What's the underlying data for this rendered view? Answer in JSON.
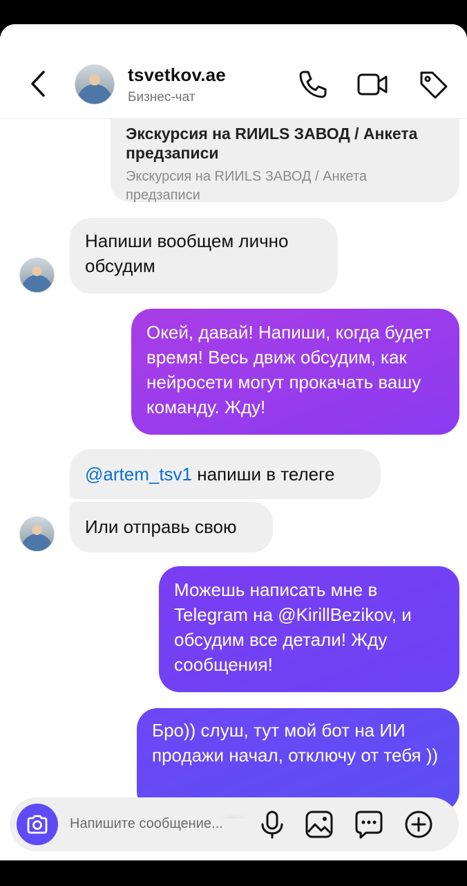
{
  "header": {
    "title": "tsvetkov.ae",
    "subtitle": "Бизнес-чат"
  },
  "messages": {
    "quoted": {
      "title": "Экскурсия на RИИLS ЗАВОД / Анкета предзаписи",
      "subtitle": "Экскурсия на RИИLS ЗАВОД / Анкета предзаписи"
    },
    "m1": "Напиши вообщем лично обсудим",
    "m2": "Окей, давай! Напиши, когда будет время! Весь движ обсудим, как нейросети могут прокачать вашу команду. Жду!",
    "m3_mention": "@artem_tsv1",
    "m3_text": " напиши в телеге",
    "m4": "Или отправь свою",
    "m5": "Можешь написать мне в Telegram на @KirillBezikov, и обсудим все детали! Жду сообщения!",
    "m6": "Бро)) слуш, тут мой бот на ИИ продажи начал, отключу от тебя ))"
  },
  "composer": {
    "placeholder": "Напишите сообщение..."
  },
  "colors": {
    "outgoing_top": "#a93de6",
    "outgoing_bottom": "#5b4ff4",
    "incoming": "#efefef",
    "accent": "#5e4bf5",
    "mention": "#0b6fd1"
  },
  "icons": [
    "back-icon",
    "phone-icon",
    "video-icon",
    "tag-icon",
    "chevron-down-icon",
    "camera-icon",
    "mic-icon",
    "gallery-icon",
    "sticker-icon",
    "plus-icon"
  ]
}
